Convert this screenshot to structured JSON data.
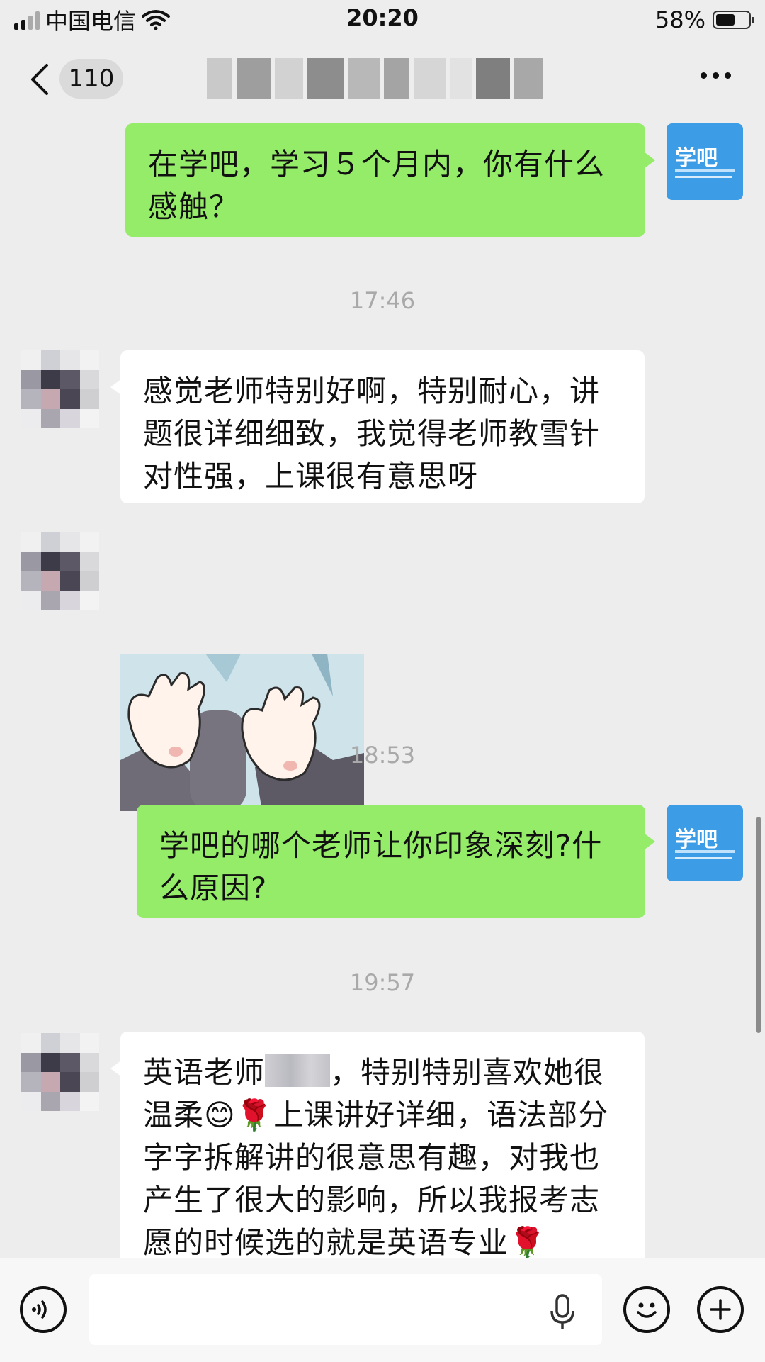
{
  "status_bar": {
    "carrier": "中国电信",
    "time": "20:20",
    "battery": "58%",
    "battery_level": 0.58
  },
  "nav": {
    "unread_count": "110"
  },
  "brand": {
    "avatar_text": "学吧"
  },
  "messages": [
    {
      "type": "text",
      "direction": "outgoing",
      "text": "在学吧，学习５个月内，你有什么感触？"
    },
    {
      "type": "timestamp",
      "text": "17:46"
    },
    {
      "type": "text",
      "direction": "incoming",
      "text": "感觉老师特别好啊，特别耐心，讲题很详细细致，我觉得老师教雪针对性强，上课很有意思呀"
    },
    {
      "type": "sticker",
      "direction": "incoming"
    },
    {
      "type": "timestamp",
      "text": "18:53"
    },
    {
      "type": "text",
      "direction": "outgoing",
      "text": "学吧的哪个老师让你印象深刻?什么原因?"
    },
    {
      "type": "timestamp",
      "text": "19:57"
    },
    {
      "type": "text",
      "direction": "incoming",
      "text_part1": "英语老师",
      "text_part2": "，特别特别喜欢她很温柔😊🌹上课讲好详细，语法部分字字拆解讲的很意思有趣，对我也产生了很大的影响，所以我报考志愿的时候选的就是英语专业🌹"
    }
  ],
  "colors": {
    "background": "#ededed",
    "outgoing_bubble": "#95ec69",
    "incoming_bubble": "#ffffff",
    "brand_blue": "#3c9de6"
  }
}
